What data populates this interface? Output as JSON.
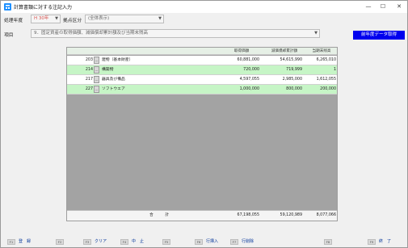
{
  "window": {
    "title": "計算書類に対する注記入力",
    "minimize": "—",
    "maximize": "☐",
    "close": "✕"
  },
  "filters": {
    "year_label": "処理年度",
    "year_value": "H 30年",
    "division_label": "拠点区分",
    "division_value": "(全体表示)",
    "item_label": "項目",
    "item_value": "9．固定資産の取得価額、減価償却累計額及び当期末残高",
    "prev_year_button": "前年度データ取得"
  },
  "grid": {
    "columns": [
      "取得価額",
      "減価償却累計額",
      "当期末残高"
    ],
    "rows": [
      {
        "code": "203",
        "name": "建物（基本財産）",
        "acq": "60,881,000",
        "dep": "54,615,990",
        "bal": "6,265,010",
        "highlight": false
      },
      {
        "code": "214",
        "name": "構築物",
        "acq": "720,000",
        "dep": "719,999",
        "bal": "1",
        "highlight": true
      },
      {
        "code": "217",
        "name": "器具及び備品",
        "acq": "4,597,055",
        "dep": "2,985,000",
        "bal": "1,612,055",
        "highlight": false
      },
      {
        "code": "227",
        "name": "ソフトウエア",
        "acq": "1,000,000",
        "dep": "800,000",
        "bal": "200,000",
        "highlight": true
      }
    ],
    "dots": "…",
    "total": {
      "label": "合　　　計",
      "acq": "67,198,055",
      "dep": "59,120,989",
      "bal": "8,077,066"
    }
  },
  "function_keys": [
    {
      "key": "F1",
      "label": "登　録"
    },
    {
      "key": "F2",
      "label": ""
    },
    {
      "key": "F3",
      "label": "クリア"
    },
    {
      "key": "F4",
      "label": "中　止"
    },
    {
      "key": "F5",
      "label": ""
    },
    {
      "key": "F6",
      "label": "行挿入"
    },
    {
      "key": "F7",
      "label": "行削除"
    },
    {
      "key": "F8",
      "label": ""
    },
    {
      "key": "F9",
      "label": "終　了"
    }
  ],
  "colors": {
    "highlight_row": "#c6f5c6",
    "normal_row": "#ffffff",
    "grid_empty": "#a3a3a3",
    "accent_button": "#0000ee"
  },
  "icons": {
    "app": "calculator-app-icon",
    "dropdown": "chevron-down-icon"
  }
}
